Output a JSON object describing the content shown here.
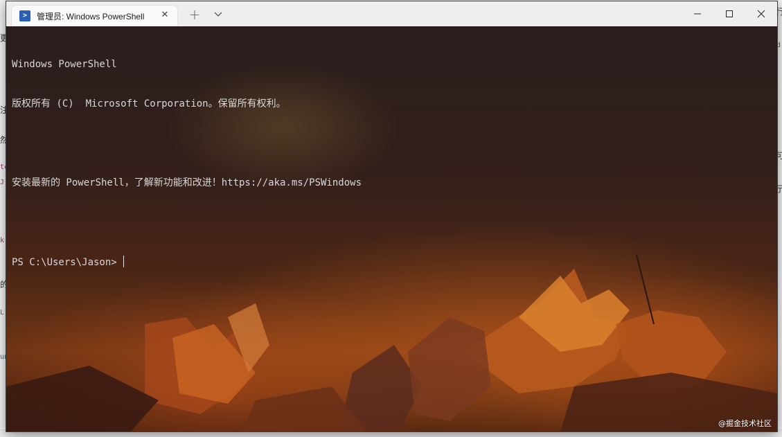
{
  "window": {
    "tab_title": "管理员: Windows PowerShell",
    "tab_icon": "powershell-icon",
    "tab_close": "✕",
    "new_tab": "+",
    "dropdown_icon": "chevron-down-icon",
    "controls": {
      "minimize": "—",
      "maximize": "☐",
      "close": "✕"
    }
  },
  "terminal": {
    "lines": [
      "Windows PowerShell",
      "版权所有 (C)  Microsoft Corporation。保留所有权利。",
      "",
      "安装最新的 PowerShell，了解新功能和改进！https://aka.ms/PSWindows",
      "",
      "PS C:\\Users\\Jason>"
    ],
    "text_color": "#d8d8d8",
    "background_theme": "autumn-leaves"
  },
  "watermark": "@掘金技术社区",
  "background_peek": {
    "left": [
      "更",
      "注",
      "然",
      "tc",
      "J",
      "k",
      "的",
      "L",
      "un"
    ],
    "right": [
      "行",
      "d",
      "可。",
      "亍"
    ]
  }
}
